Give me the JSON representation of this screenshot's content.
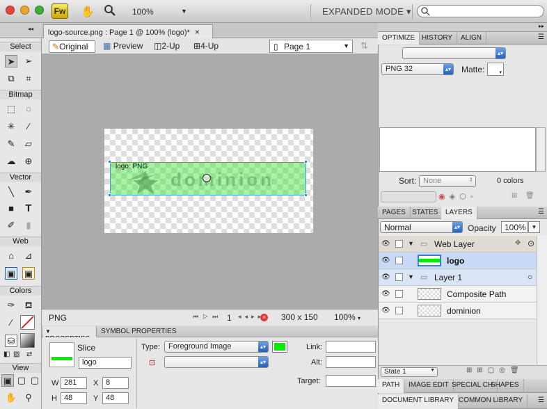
{
  "app": {
    "logo": "Fw",
    "zoom": "100%",
    "mode": "EXPANDED MODE",
    "mode_arrow": "▾",
    "search_placeholder": ""
  },
  "tools": {
    "sections": [
      "Select",
      "Bitmap",
      "Vector",
      "Web",
      "Colors",
      "View"
    ]
  },
  "document": {
    "tab_title": "logo-source.png : Page 1 @ 100% (logo)*",
    "tab_close": "×",
    "views": [
      "Original",
      "Preview",
      "2-Up",
      "4-Up"
    ],
    "page": "Page 1",
    "slice_label": "logo: PNG",
    "status": {
      "format": "PNG",
      "frame": "1",
      "size": "300 x 150",
      "zoom": "100%"
    }
  },
  "properties": {
    "tabs": [
      "PROPERTIES",
      "SYMBOL PROPERTIES"
    ],
    "object_type": "Slice",
    "name": "logo",
    "w_label": "W",
    "w": "281",
    "h_label": "H",
    "h": "48",
    "x_label": "X",
    "x": "8",
    "y_label": "Y",
    "y": "48",
    "type_label": "Type:",
    "type_value": "Foreground Image",
    "link_label": "Link:",
    "alt_label": "Alt:",
    "target_label": "Target:",
    "slice_color": "#00ee00"
  },
  "optimize": {
    "tabs": [
      "OPTIMIZE",
      "HISTORY",
      "ALIGN"
    ],
    "format": "PNG 32",
    "matte_label": "Matte:",
    "sort_label": "Sort:",
    "sort_value": "None",
    "colors": "0 colors"
  },
  "layers": {
    "tabs": [
      "PAGES",
      "STATES",
      "LAYERS"
    ],
    "blend": "Normal",
    "opacity_label": "Opacity",
    "opacity": "100%",
    "rows": [
      {
        "name": "Web Layer",
        "kind": "folder"
      },
      {
        "name": "logo",
        "kind": "slice"
      },
      {
        "name": "Layer 1",
        "kind": "folder"
      },
      {
        "name": "Composite Path",
        "kind": "object"
      },
      {
        "name": "dominion",
        "kind": "object"
      }
    ],
    "state": "State 1"
  },
  "bottom_tabs": [
    "PATH",
    "IMAGE EDIT",
    "SPECIAL CH",
    "SHAPES"
  ],
  "lib_tabs": [
    "DOCUMENT LIBRARY",
    "COMMON LIBRARY"
  ],
  "colors": {
    "accent": "#3a7bd5",
    "slice": "#00ee00"
  }
}
